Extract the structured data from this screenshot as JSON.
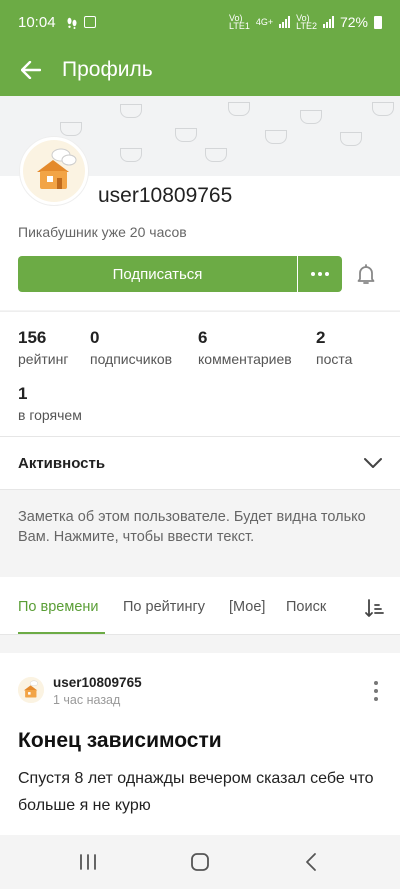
{
  "status_bar": {
    "time": "10:04",
    "net1": "Vo)\nLTE1",
    "net_type": "4G+",
    "net2": "Vo)\nLTE2",
    "battery": "72%"
  },
  "app_bar": {
    "title": "Профиль"
  },
  "profile": {
    "username": "user10809765",
    "since": "Пикабушник уже 20 часов",
    "subscribe_label": "Подписаться"
  },
  "stats": [
    {
      "value": "156",
      "label": "рейтинг"
    },
    {
      "value": "0",
      "label": "подписчиков"
    },
    {
      "value": "6",
      "label": "комментариев"
    },
    {
      "value": "2",
      "label": "поста"
    },
    {
      "value": "1",
      "label": "в горячем"
    }
  ],
  "activity": {
    "label": "Активность"
  },
  "note": {
    "text": "Заметка об этом пользователе. Будет видна только Вам. Нажмите, чтобы ввести текст."
  },
  "tabs": [
    {
      "label": "По времени",
      "active": true
    },
    {
      "label": "По рейтингу",
      "active": false
    },
    {
      "label": "[Мое]",
      "active": false
    },
    {
      "label": "Поиск",
      "active": false
    }
  ],
  "post": {
    "author": "user10809765",
    "time": "1 час назад",
    "title": "Конец зависимости",
    "text": "Спустя 8 лет однажды вечером сказал себе что больше я не курю"
  },
  "colors": {
    "brand_green": "#6cab45",
    "active_tab": "#5a9e36"
  }
}
